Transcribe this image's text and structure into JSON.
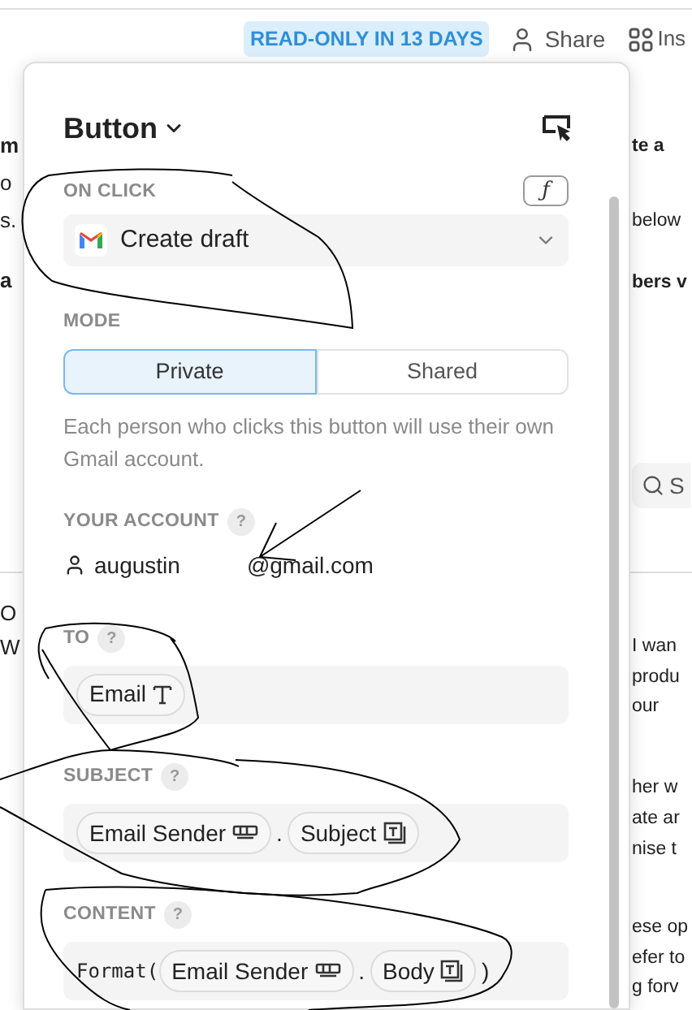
{
  "topbar": {
    "badge": "READ-ONLY IN 13 DAYS",
    "share": "Share",
    "insert": "Ins"
  },
  "background": {
    "left": [
      {
        "text": "m",
        "bold": true
      },
      {
        "text": "o",
        "bold": false
      },
      {
        "text": "s.",
        "bold": false
      },
      {
        "text": "a",
        "bold": true
      },
      {
        "text": "O",
        "bold": false
      },
      {
        "text": "W",
        "bold": false
      }
    ],
    "right": [
      {
        "text": "te a",
        "bold": true
      },
      {
        "text": "below",
        "bold": false
      },
      {
        "text": "bers v",
        "bold": true
      },
      {
        "text": "I wan",
        "bold": false
      },
      {
        "text": "produ",
        "bold": false
      },
      {
        "text": "our",
        "bold": false
      },
      {
        "text": "her w",
        "bold": false
      },
      {
        "text": "ate ar",
        "bold": false
      },
      {
        "text": "nise t",
        "bold": false
      },
      {
        "text": "ese op",
        "bold": false
      },
      {
        "text": "efer to",
        "bold": false
      },
      {
        "text": "g forv",
        "bold": false
      }
    ],
    "search": "S"
  },
  "panel": {
    "title": "Button",
    "on_click": {
      "label": "ON CLICK",
      "formula": "ƒ",
      "action": "Create draft"
    },
    "mode": {
      "label": "MODE",
      "options": [
        {
          "label": "Private",
          "selected": true
        },
        {
          "label": "Shared",
          "selected": false
        }
      ],
      "description": "Each person who clicks this button will use their own Gmail account."
    },
    "account": {
      "label": "YOUR ACCOUNT",
      "help": "?",
      "user": "augustin",
      "domain": "@gmail.com"
    },
    "fields": [
      {
        "label": "TO",
        "help": "?",
        "tokens": [
          {
            "kind": "text-chip",
            "text": "Email"
          }
        ]
      },
      {
        "label": "SUBJECT",
        "help": "?",
        "tokens": [
          {
            "kind": "link-chip",
            "text": "Email Sender"
          },
          {
            "kind": "punct",
            "text": "."
          },
          {
            "kind": "field-chip",
            "text": "Subject"
          }
        ]
      },
      {
        "label": "CONTENT",
        "help": "?",
        "tokens": [
          {
            "kind": "code",
            "text": "Format("
          },
          {
            "kind": "link-chip",
            "text": "Email Sender"
          },
          {
            "kind": "punct",
            "text": "."
          },
          {
            "kind": "field-chip",
            "text": "Body"
          },
          {
            "kind": "punct",
            "text": ")"
          }
        ]
      }
    ]
  }
}
